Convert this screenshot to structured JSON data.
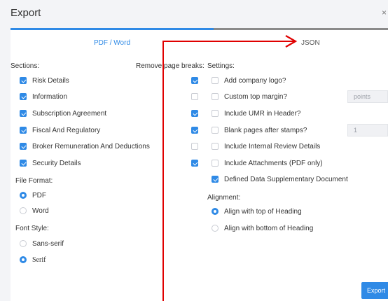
{
  "window": {
    "title": "Export",
    "close_glyph": "×"
  },
  "tabs": {
    "pdf_word": "PDF / Word",
    "json": "JSON"
  },
  "sections": {
    "heading": "Sections:",
    "remove_breaks_heading": "Remove page breaks:",
    "items": [
      {
        "label": "Risk Details",
        "checked": true,
        "remove_break": true
      },
      {
        "label": "Information",
        "checked": true,
        "remove_break": false
      },
      {
        "label": "Subscription Agreement",
        "checked": true,
        "remove_break": true
      },
      {
        "label": "Fiscal And Regulatory",
        "checked": true,
        "remove_break": true
      },
      {
        "label": "Broker Remuneration And Deductions",
        "checked": true,
        "remove_break": false
      },
      {
        "label": "Security Details",
        "checked": true,
        "remove_break": true
      }
    ]
  },
  "file_format": {
    "heading": "File Format:",
    "options": [
      {
        "label": "PDF",
        "selected": true
      },
      {
        "label": "Word",
        "selected": false
      }
    ]
  },
  "font_style": {
    "heading": "Font Style:",
    "options": [
      {
        "label": "Sans-serif",
        "selected": false
      },
      {
        "label": "Serif",
        "selected": true
      }
    ]
  },
  "settings": {
    "heading": "Settings:",
    "items": [
      {
        "label": "Add company logo?",
        "checked": false
      },
      {
        "label": "Custom top margin?",
        "checked": false
      },
      {
        "label": "Include UMR in Header?",
        "checked": false
      },
      {
        "label": "Blank pages after stamps?",
        "checked": false
      },
      {
        "label": "Include Internal Review Details",
        "checked": false
      },
      {
        "label": "Include Attachments (PDF only)",
        "checked": false
      },
      {
        "label": "Defined Data Supplementary Document",
        "checked": true
      }
    ],
    "margin_placeholder": "points",
    "blank_pages_value": "1"
  },
  "alignment": {
    "heading": "Alignment:",
    "options": [
      {
        "label": "Align with top of Heading",
        "selected": true
      },
      {
        "label": "Align with bottom of Heading",
        "selected": false
      }
    ]
  },
  "buttons": {
    "export": "Export"
  },
  "colors": {
    "accent": "#2f8ae6",
    "arrow": "#e00000"
  }
}
